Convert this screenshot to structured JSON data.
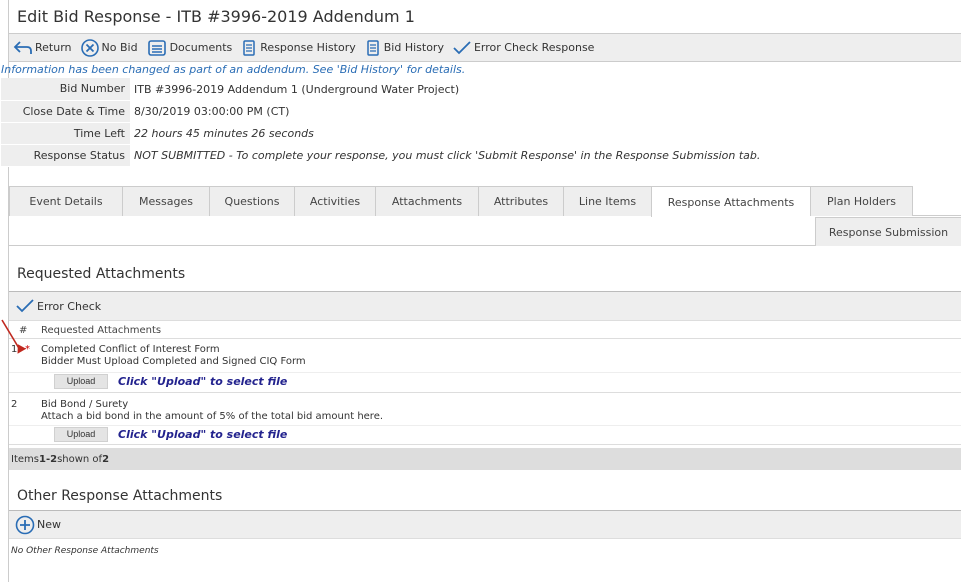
{
  "title": "Edit Bid Response - ITB #3996-2019 Addendum 1",
  "toolbar": {
    "return_label": "Return",
    "no_bid_label": "No Bid",
    "documents_label": "Documents",
    "response_history_label": "Response History",
    "bid_history_label": "Bid History",
    "error_check_label": "Error Check Response"
  },
  "notice": "Information has been changed as part of an addendum. See 'Bid History' for details.",
  "info": {
    "bid_number_label": "Bid Number",
    "bid_number_value": "ITB #3996-2019 Addendum 1 (Underground Water Project)",
    "close_date_label": "Close Date & Time",
    "close_date_value": "8/30/2019 03:00:00 PM (CT)",
    "time_left_label": "Time Left",
    "time_left_value": "22 hours 45 minutes 26 seconds",
    "status_label": "Response Status",
    "status_value": "NOT SUBMITTED - To complete your response, you must click 'Submit Response' in the Response Submission tab."
  },
  "tabs": [
    "Event Details",
    "Messages",
    "Questions",
    "Activities",
    "Attachments",
    "Attributes",
    "Line Items",
    "Response Attachments",
    "Plan Holders"
  ],
  "active_tab": "Response Attachments",
  "tab_row2": "Response Submission",
  "requested": {
    "section_title": "Requested Attachments",
    "error_check_label": "Error Check",
    "col_num": "#",
    "col_name": "Requested Attachments",
    "rows": [
      {
        "num": "1",
        "required": "*",
        "name": "Completed Conflict of Interest Form",
        "desc": "Bidder Must Upload Completed and Signed CIQ Form",
        "upload": "Upload",
        "hint": "Click \"Upload\" to select file"
      },
      {
        "num": "2",
        "required": "",
        "name": "Bid Bond / Surety",
        "desc": "Attach a bid bond in the amount of 5% of the total bid amount here.",
        "upload": "Upload",
        "hint": "Click \"Upload\" to select file"
      }
    ],
    "footer_prefix": "Items ",
    "footer_range": "1-2",
    "footer_mid": " shown of ",
    "footer_total": "2"
  },
  "other": {
    "section_title": "Other Response Attachments",
    "new_label": "New",
    "empty_note": "No Other Response Attachments"
  },
  "colors": {
    "accent_blue": "#2a6db5",
    "required_red": "#c00",
    "annotation_arrow": "#c0281e"
  }
}
